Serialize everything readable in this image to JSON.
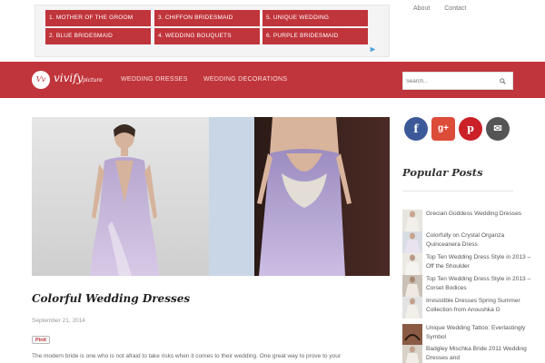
{
  "ad": {
    "links": [
      "1. MOTHER OF THE GROOM",
      "3. CHIFFON BRIDESMAID",
      "5. UNIQUE WEDDING",
      "2. BLUE BRIDESMAID",
      "4. WEDDING BOUQUETS",
      "6. PURPLE BRIDESMAID"
    ],
    "flag_icon": "adchoices-icon"
  },
  "top_nav": {
    "about": "About",
    "contact": "Contact"
  },
  "brand": {
    "logo_letters": "Vv",
    "name": "vivify",
    "tagline": "picture"
  },
  "nav": {
    "item1": "WEDDING DRESSES",
    "item2": "WEDDING DECORATIONS"
  },
  "search": {
    "placeholder": "Search..."
  },
  "post": {
    "title": "Colorful Wedding Dresses",
    "date": "September 21, 2014",
    "pin_label": "Pinit",
    "excerpt": "The modern bride is one who is not afraid to take risks when it comes to their wedding. One great way to prove to your"
  },
  "social": {
    "facebook": "f",
    "googleplus": "g+",
    "pinterest": "p",
    "email": "✉"
  },
  "popular": {
    "heading": "Popular Posts",
    "items": [
      "Grecian Goddess Wedding Dresses",
      "Colorfully on Crystal Organza Quinceanera Dress",
      "Top Ten Wedding Dress Style in 2013 – Off the Shoulder",
      "Top Ten Wedding Dress Style in 2013 – Corset Bodices",
      "Irresistible Dresses Spring Summer Collection from Anoushka G",
      "Unique Wedding Tattoo: Everlastingly Symbol",
      "Badgley Mischka Bride 2011 Wedding Dresses and"
    ]
  },
  "colors": {
    "brand_red": "#c0353b",
    "facebook": "#3b5998",
    "googleplus": "#dd4b39",
    "pinterest": "#cb2027",
    "email": "#555555"
  }
}
